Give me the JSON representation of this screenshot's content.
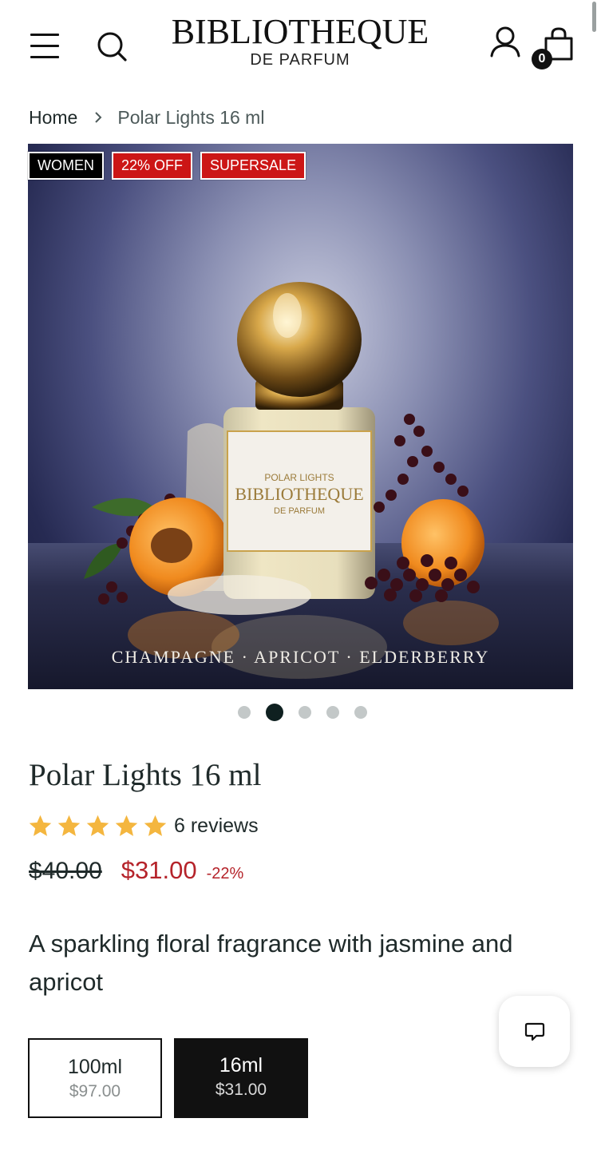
{
  "header": {
    "logo_main": "BIBLIOTHEQUE",
    "logo_sub": "DE PARFUM",
    "cart_count": "0",
    "icons": [
      "menu-icon",
      "search-icon",
      "account-icon",
      "cart-icon"
    ]
  },
  "breadcrumb": {
    "home": "Home",
    "current": "Polar Lights 16 ml"
  },
  "gallery": {
    "badges": {
      "women": "WOMEN",
      "off": "22% OFF",
      "sale": "SUPERSALE"
    },
    "caption": "CHAMPAGNE · APRICOT · ELDERBERRY",
    "label_line1": "POLAR LIGHTS",
    "label_line2": "BIBLIOTHEQUE",
    "label_line3": "DE PARFUM",
    "dots_count": 5,
    "active_dot": 2
  },
  "product": {
    "title": "Polar Lights 16 ml",
    "rating": 5,
    "reviews": "6 reviews",
    "old_price": "$40.00",
    "new_price": "$31.00",
    "discount": "-22%",
    "description": "A sparkling floral fragrance with jasmine and apricot"
  },
  "variants": [
    {
      "size": "100ml",
      "price": "$97.00",
      "selected": false
    },
    {
      "size": "16ml",
      "price": "$31.00",
      "selected": true
    }
  ],
  "colors": {
    "sale_red": "#cc1616",
    "price_red": "#b5232a",
    "star": "#f4b63f",
    "dark": "#111111"
  }
}
